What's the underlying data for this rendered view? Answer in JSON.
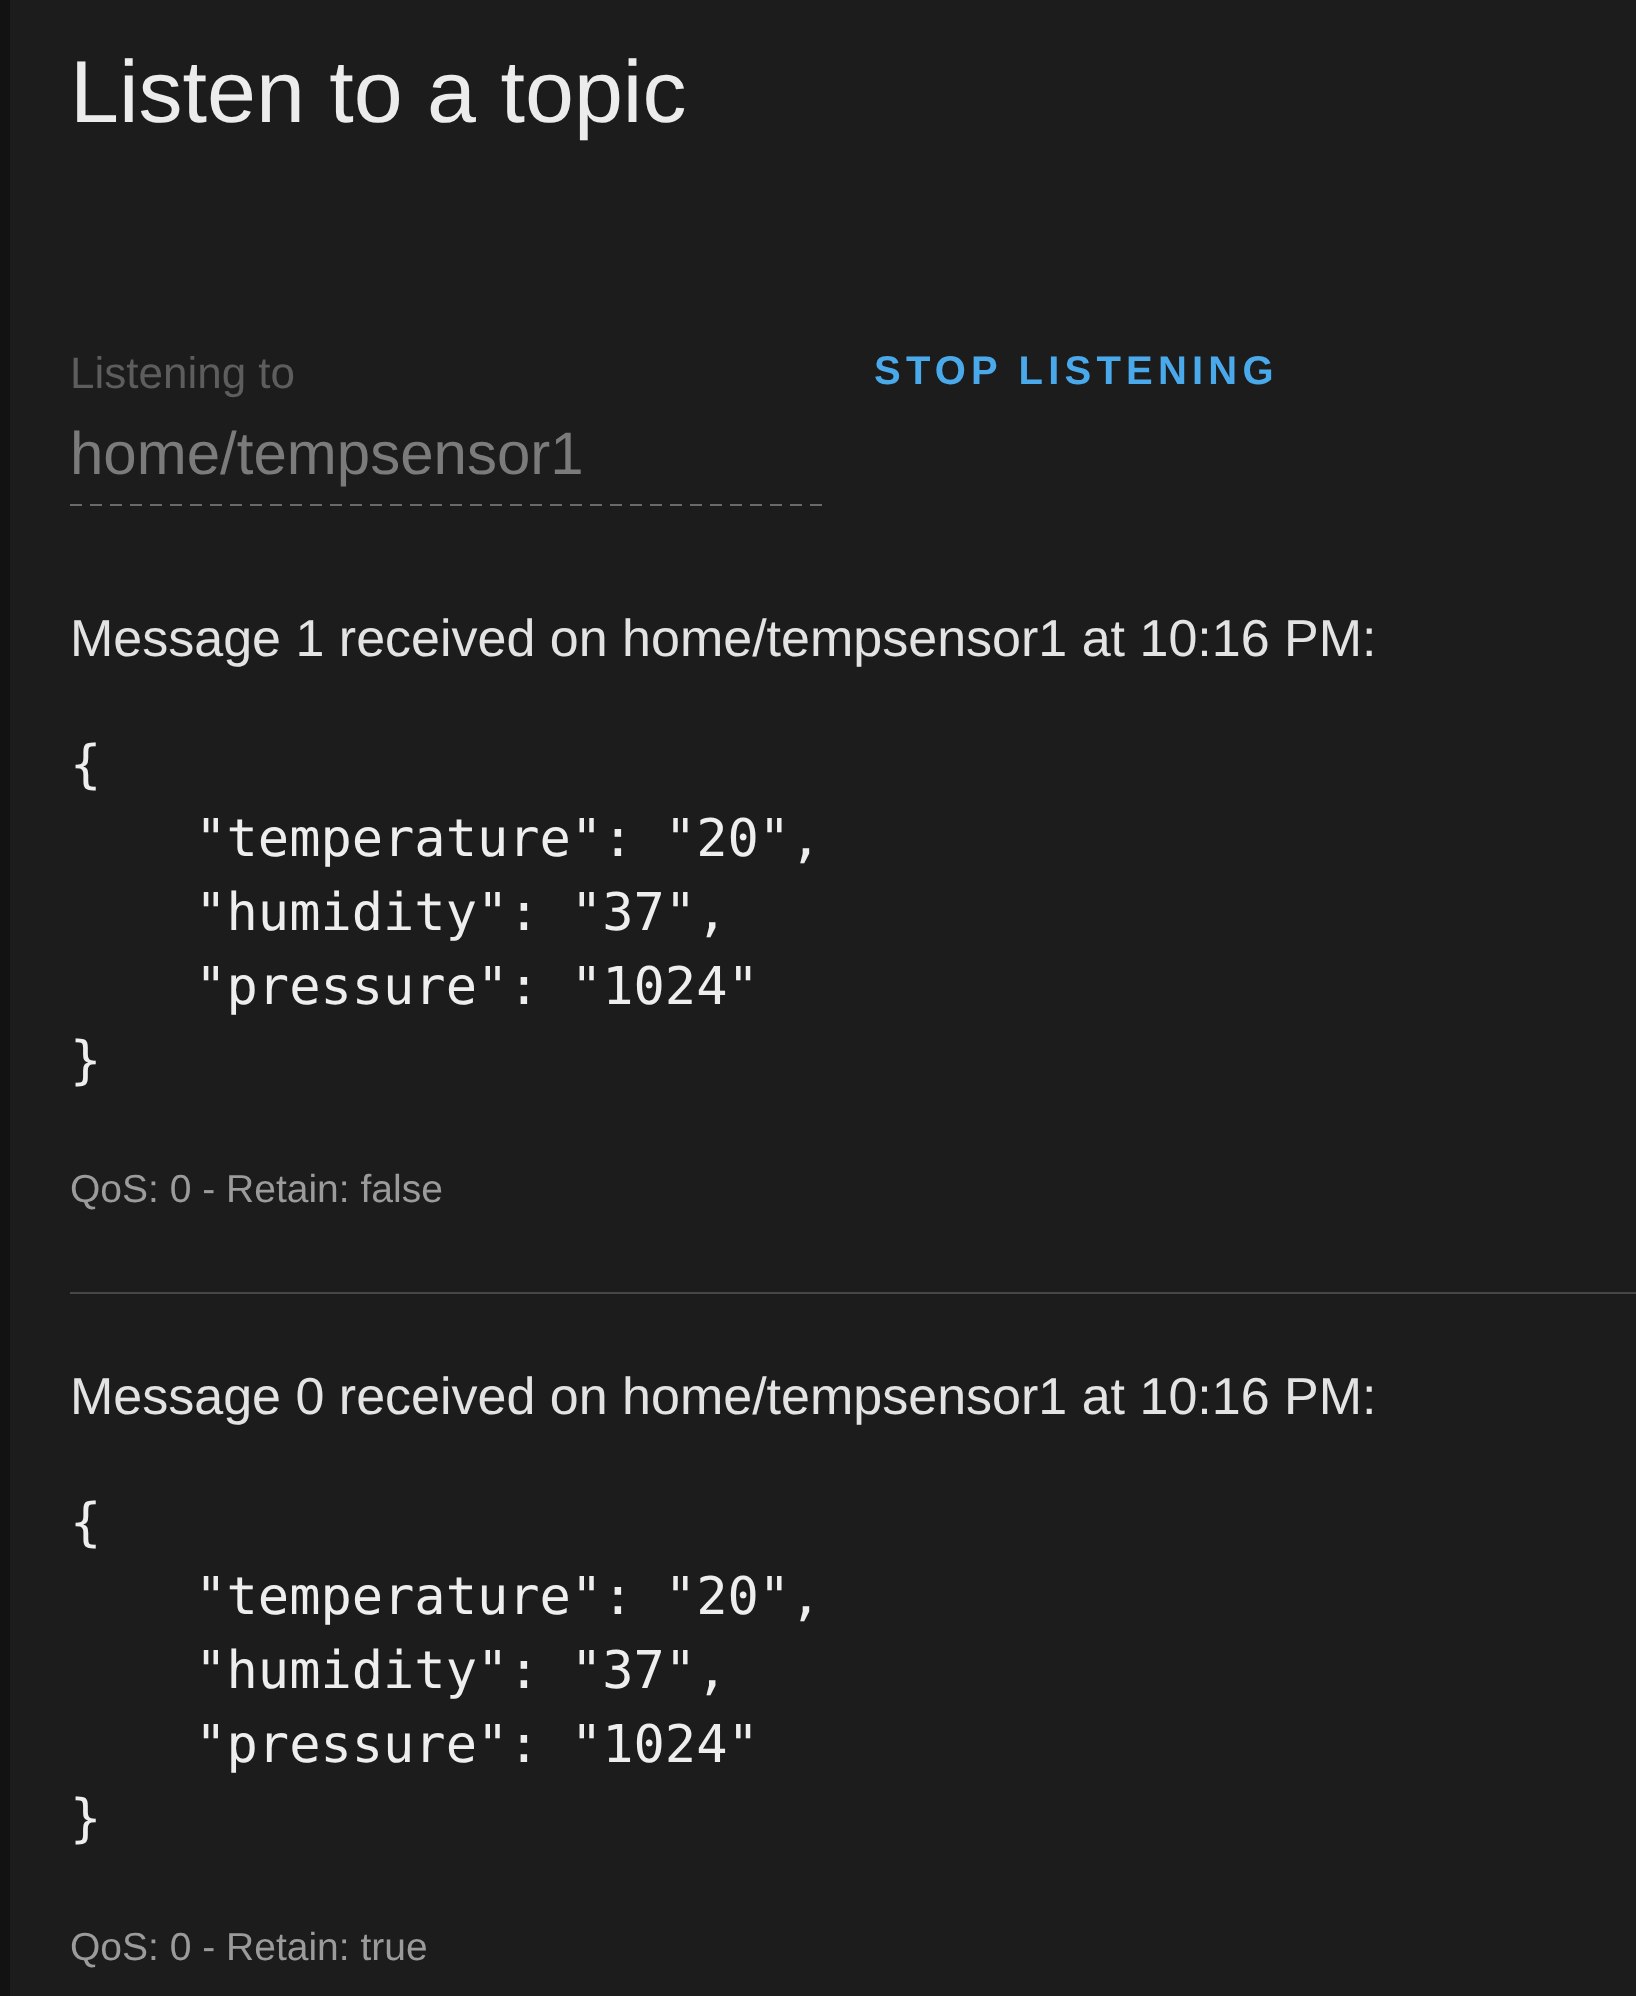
{
  "title": "Listen to a topic",
  "topic_field": {
    "label": "Listening to",
    "value": "home/tempsensor1",
    "disabled": true
  },
  "stop_button": {
    "label": "STOP LISTENING"
  },
  "messages": [
    {
      "heading": "Message 1 received on home/tempsensor1 at 10:16 PM:",
      "payload": "{\n    \"temperature\": \"20\",\n    \"humidity\": \"37\",\n    \"pressure\": \"1024\"\n}",
      "details": "QoS: 0 - Retain: false"
    },
    {
      "heading": "Message 0 received on home/tempsensor1 at 10:16 PM:",
      "payload": "{\n    \"temperature\": \"20\",\n    \"humidity\": \"37\",\n    \"pressure\": \"1024\"\n}",
      "details": "QoS: 0 - Retain: true"
    }
  ]
}
